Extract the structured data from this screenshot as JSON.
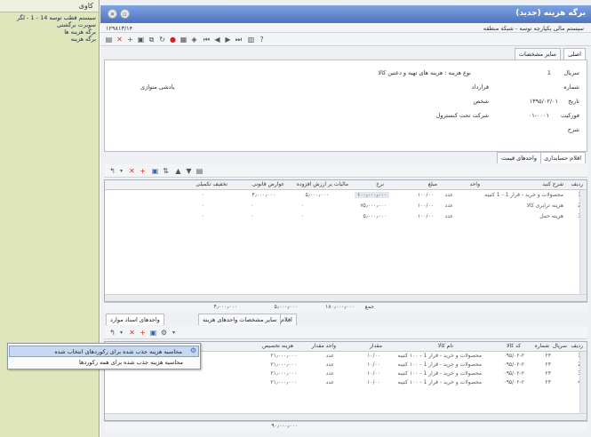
{
  "sidebar": {
    "top_label": "کاوی",
    "items": [
      "سیستم قطب توسه 14 - 1 - لگر",
      "سوبرت برگشتی",
      "برگه هزینه ها",
      "برگه هزینه"
    ]
  },
  "window": {
    "title": "برگه هزینه (جدید)",
    "number": "۱۲۹۸۱۳/۱۴",
    "breadcrumb": "سیستم مالی یکپارچه توسه - شبکه منطقه"
  },
  "top_tabs": [
    "اصلی",
    "سایر مشخصات"
  ],
  "header_fields": {
    "serial_label": "سریال",
    "serial_value": "1",
    "doc_type_value": "نوع هزینه : هزینه های تهیه و دعتین کالا",
    "shipment_label": "شماره",
    "reference_label": "قرارداد",
    "account_label": "شخص",
    "description_value": "یادشی متوازی",
    "date_label": "تاریخ",
    "date_value": "۱۳۹۵/۰۲/۰۱",
    "cost_center_label": "فورکیت",
    "cost_center_value": "۰۱-۰۰۰۱",
    "company_value": "شرکت تحت کنسترول",
    "status_label": "شرح"
  },
  "mid_tabs": [
    "اقلام حسابداری",
    "واحدهای قیمت"
  ],
  "grid1": {
    "headers": [
      "ردیف",
      "شرح کنید",
      "واحد",
      "مبلغ",
      "نرخ",
      "مالیات بر ارزش افزوده",
      "عوارض قانونی",
      "تخفیف تکمیلی"
    ],
    "rows": [
      {
        "num": "1",
        "desc": "محصولات و خرید - قرار 1 - 1 کتیبه",
        "unit": "عدد",
        "qty": "۱۰۰/۰۰",
        "price": "۱۰۰٫۰۰۰٫۰۰۰",
        "vat": "۵٫۰۰۰٫۰۰۰",
        "tax": "۴٫۰۰۰٫۰۰۰",
        "disc": "۰"
      },
      {
        "num": "2",
        "desc": "هزینه ترابری کالا",
        "unit": "عدد",
        "qty": "۱۰۰/۰۰",
        "price": "۷۵٫۰۰۰٫۰۰۰",
        "vat": "۰",
        "tax": "۰",
        "disc": "۰"
      },
      {
        "num": "3",
        "desc": "هزینه حمل",
        "unit": "عدد",
        "qty": "۱۰۰/۰۰",
        "price": "۵٫۰۰۰٫۰۰۰",
        "vat": "۰",
        "tax": "۰",
        "disc": "۰"
      }
    ],
    "footer": {
      "total_label": "جمع",
      "total": "۱۸۰٫۰۰۰٫۰۰۰",
      "vat_total": "۵٫۰۰۰٫۰۰۰",
      "tax_total": "۴٫۰۰۰٫۰۰۰"
    }
  },
  "bottom_tabs": [
    "اقلام",
    "سایر مشخصات واحدهای هزینه",
    "واحدهای اسناد موارد"
  ],
  "grid2": {
    "headers": [
      "ردیف",
      "سریال",
      "شماره",
      "کد کالا",
      "نام کالا",
      "مقدار",
      "واحد مقدار",
      "هزینه تخصیص"
    ],
    "rows": [
      {
        "num": "1",
        "serial": "۲۳",
        "code": "۰۹۵/۰۲-۲",
        "name": "محصولات و خرید - قرار 1 - ۱۰۰ کتیبه",
        "qty": "۱۰/۰۰",
        "unit": "عدد",
        "cost": "۲۱٫۰۰۰٫۰۰۰"
      },
      {
        "num": "2",
        "serial": "۲۳",
        "code": "۰۹۵/۰۲-۲",
        "name": "محصولات و خرید - قرار 1 - ۱۰۰ کتیبه",
        "qty": "۱۰/۰۰",
        "unit": "عدد",
        "cost": "۲۱٫۰۰۰٫۰۰۰"
      },
      {
        "num": "3",
        "serial": "۲۳",
        "code": "۰۹۵/۰۲-۲",
        "name": "محصولات و خرید - قرار 1 - ۱۰۰ کتیبه",
        "qty": "۱۰/۰۰",
        "unit": "عدد",
        "cost": "۲۱٫۰۰۰٫۰۰۰"
      },
      {
        "num": "4",
        "serial": "۲۳",
        "code": "۰۹۵/۰۲-۲",
        "name": "محصولات و خرید - قرار 1 - ۱۰۰ کتیبه",
        "qty": "۱۰/۰۰",
        "unit": "عدد",
        "cost": "۲۱٫۰۰۰٫۰۰۰"
      }
    ],
    "footer_total": "۹۰٫۰۰۰٫۰۰۰"
  },
  "context_menu": {
    "item1": "محاسبه هزینه جذب شده برای رکوردهای انتخاب شده",
    "item2": "محاسبه هزینه جذب شده برای همه رکوردها"
  },
  "colors": {
    "title_bar": "#4d73bf",
    "sidebar": "#dfe6bb",
    "menu_highlight": "#c6d9f2"
  }
}
